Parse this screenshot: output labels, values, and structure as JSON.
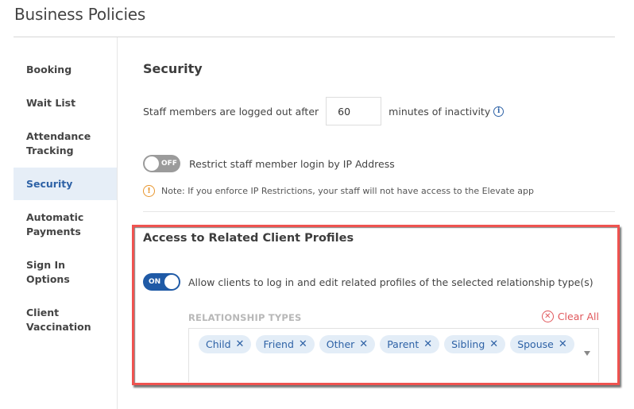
{
  "header": {
    "title": "Business Policies"
  },
  "sidebar": {
    "items": [
      {
        "label": "Booking",
        "active": false
      },
      {
        "label": "Wait List",
        "active": false
      },
      {
        "label": "Attendance Tracking",
        "active": false
      },
      {
        "label": "Security",
        "active": true
      },
      {
        "label": "Automatic Payments",
        "active": false
      },
      {
        "label": "Sign In Options",
        "active": false
      },
      {
        "label": "Client Vaccination",
        "active": false
      }
    ]
  },
  "security": {
    "title": "Security",
    "logout_prefix": "Staff members are logged out after",
    "logout_minutes": "60",
    "logout_suffix": "minutes of inactivity",
    "info_icon": "info-circle-icon",
    "ip_toggle_state": "OFF",
    "ip_label": "Restrict staff member login by IP Address",
    "note_icon": "warning-circle-icon",
    "note": "Note: If you enforce IP Restrictions, your staff will not have access to the Elevate app"
  },
  "related_profiles": {
    "title": "Access to Related Client Profiles",
    "toggle_state": "ON",
    "allow_label": "Allow clients to log in and edit related profiles of the selected relationship type(s)",
    "relationship_label": "RELATIONSHIP TYPES",
    "clear_all": "Clear All",
    "selected": [
      "Child",
      "Friend",
      "Other",
      "Parent",
      "Sibling",
      "Spouse"
    ],
    "remove_glyph": "✕"
  },
  "colors": {
    "accent": "#2e62a6",
    "toggle_on": "#1f5aa6",
    "toggle_off": "#9b9b9b",
    "warning": "#e8962e",
    "clear_all": "#e0575b",
    "highlight_border": "#ef5350",
    "chip_bg": "#e3edf7",
    "active_nav_bg": "#e6eef7"
  }
}
